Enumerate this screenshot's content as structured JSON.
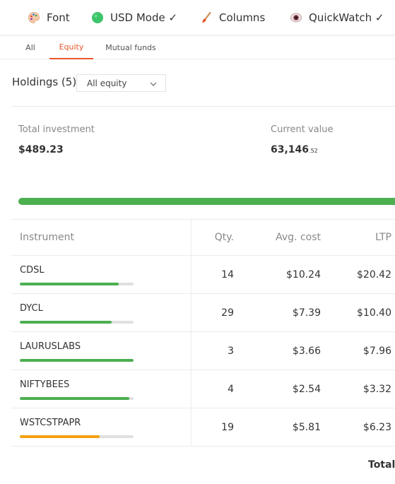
{
  "toolbar": {
    "font_label": "Font",
    "usd_label": "USD Mode ✓",
    "columns_label": "Columns",
    "quickwatch_label": "QuickWatch ✓",
    "icons": {
      "font": "palette-icon",
      "usd": "green-circle-icon",
      "columns": "brush-icon",
      "quickwatch": "eye-icon"
    }
  },
  "tabs": [
    {
      "label": "All",
      "active": false
    },
    {
      "label": "Equity",
      "active": true
    },
    {
      "label": "Mutual funds",
      "active": false
    }
  ],
  "holdings": {
    "title": "Holdings (5)",
    "filter_value": "All equity"
  },
  "summary": {
    "investment_label": "Total investment",
    "investment_value": "$489.23",
    "current_label": "Current value",
    "current_value_main": "63,146",
    "current_value_decimal": ".52",
    "overall_progress": 1.0
  },
  "table": {
    "headers": {
      "instrument": "Instrument",
      "qty": "Qty.",
      "avg": "Avg. cost",
      "ltp": "LTP"
    },
    "rows": [
      {
        "instrument": "CDSL",
        "qty": "14",
        "avg": "$10.24",
        "ltp": "$20.42",
        "progress": 0.87,
        "color": "#4caf50"
      },
      {
        "instrument": "DYCL",
        "qty": "29",
        "avg": "$7.39",
        "ltp": "$10.40",
        "progress": 0.81,
        "color": "#4caf50"
      },
      {
        "instrument": "LAURUSLABS",
        "qty": "3",
        "avg": "$3.66",
        "ltp": "$7.96",
        "progress": 1.0,
        "color": "#4caf50"
      },
      {
        "instrument": "NIFTYBEES",
        "qty": "4",
        "avg": "$2.54",
        "ltp": "$3.32",
        "progress": 0.96,
        "color": "#4caf50"
      },
      {
        "instrument": "WSTCSTPAPR",
        "qty": "19",
        "avg": "$5.81",
        "ltp": "$6.23",
        "progress": 0.7,
        "color": "#f5a00f"
      }
    ],
    "total_label": "Total"
  }
}
